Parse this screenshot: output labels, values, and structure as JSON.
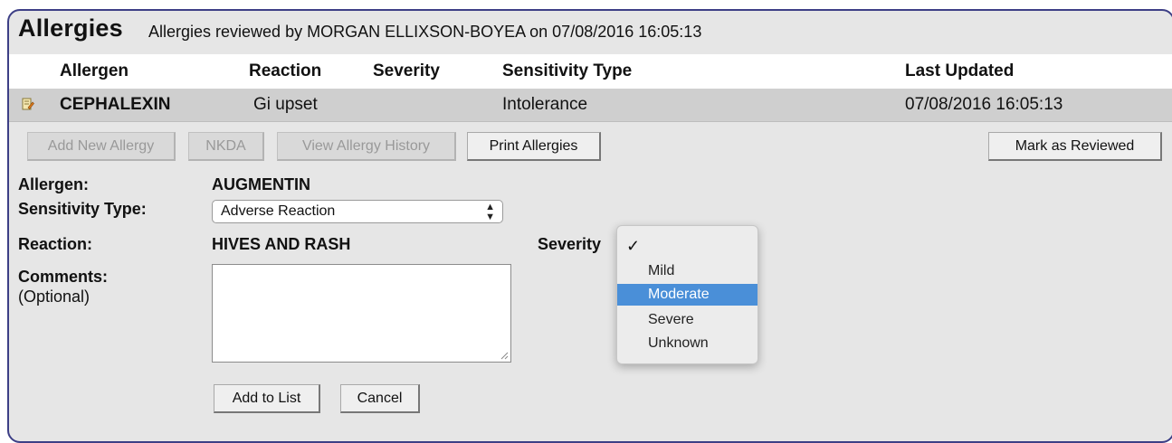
{
  "panel": {
    "title": "Allergies",
    "subtitle": "Allergies reviewed by MORGAN ELLIXSON-BOYEA on 07/08/2016 16:05:13"
  },
  "grid": {
    "headers": {
      "allergen": "Allergen",
      "reaction": "Reaction",
      "severity": "Severity",
      "sensitivity_type": "Sensitivity Type",
      "last_updated": "Last Updated"
    },
    "rows": [
      {
        "allergen": "CEPHALEXIN",
        "reaction": "Gi upset",
        "severity": "",
        "sensitivity_type": "Intolerance",
        "last_updated": "07/08/2016 16:05:13"
      }
    ]
  },
  "toolbar": {
    "add_new_allergy": "Add New Allergy",
    "nkda": "NKDA",
    "view_allergy_history": "View Allergy History",
    "print_allergies": "Print Allergies",
    "mark_as_reviewed": "Mark as Reviewed"
  },
  "form": {
    "allergen_label": "Allergen:",
    "allergen_value": "AUGMENTIN",
    "sensitivity_type_label": "Sensitivity Type:",
    "sensitivity_type_value": "Adverse Reaction",
    "reaction_label": "Reaction:",
    "reaction_value": "HIVES AND RASH",
    "severity_label": "Severity",
    "comments_label": "Comments:",
    "comments_hint": "(Optional)",
    "comments_value": "",
    "add_to_list": "Add to List",
    "cancel": "Cancel"
  },
  "severity_dropdown": {
    "check_glyph": "✓",
    "options": [
      "",
      "Mild",
      "Moderate",
      "Severe",
      "Unknown"
    ],
    "highlighted": "Moderate",
    "highlight_color": "#4a8fd8"
  },
  "icons": {
    "edit": "edit-note-icon",
    "select_arrows": "updown-arrows-icon",
    "resize": "resize-grip-icon"
  }
}
